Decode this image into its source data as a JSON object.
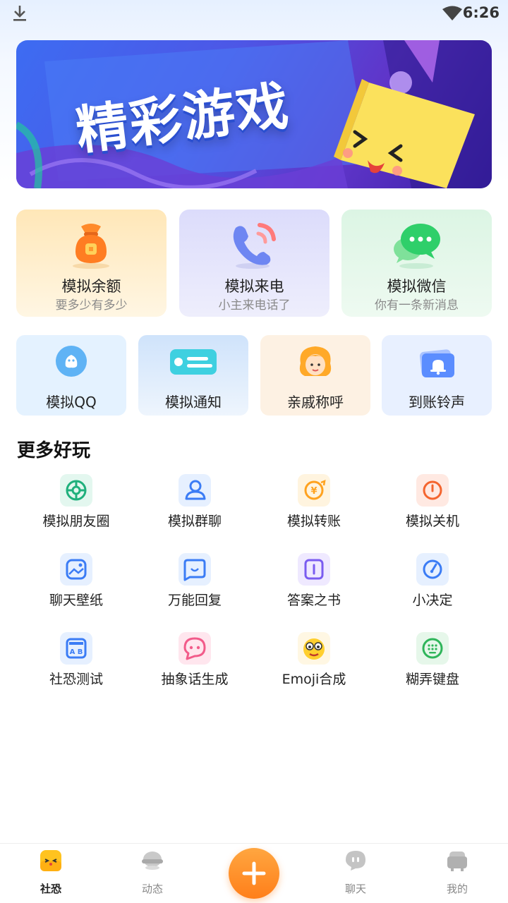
{
  "status_bar": {
    "time": "6:26"
  },
  "banner": {
    "title": "精彩游戏"
  },
  "feature_cards": [
    {
      "title": "模拟余额",
      "subtitle": "要多少有多少",
      "icon": "money-bag-icon"
    },
    {
      "title": "模拟来电",
      "subtitle": "小主来电话了",
      "icon": "phone-call-icon"
    },
    {
      "title": "模拟微信",
      "subtitle": "你有一条新消息",
      "icon": "wechat-icon"
    }
  ],
  "small_cards": [
    {
      "title": "模拟QQ",
      "icon": "qq-icon"
    },
    {
      "title": "模拟通知",
      "icon": "notification-icon"
    },
    {
      "title": "亲戚称呼",
      "icon": "relative-avatar-icon"
    },
    {
      "title": "到账铃声",
      "icon": "bell-icon"
    }
  ],
  "more": {
    "title": "更多好玩",
    "items": [
      {
        "label": "模拟朋友圈",
        "icon": "moments-icon"
      },
      {
        "label": "模拟群聊",
        "icon": "group-chat-icon"
      },
      {
        "label": "模拟转账",
        "icon": "transfer-icon"
      },
      {
        "label": "模拟关机",
        "icon": "power-icon"
      },
      {
        "label": "聊天壁纸",
        "icon": "wallpaper-icon"
      },
      {
        "label": "万能回复",
        "icon": "reply-icon"
      },
      {
        "label": "答案之书",
        "icon": "answer-book-icon"
      },
      {
        "label": "小决定",
        "icon": "decision-icon"
      },
      {
        "label": "社恐测试",
        "icon": "social-test-icon"
      },
      {
        "label": "抽象话生成",
        "icon": "abstract-talk-icon"
      },
      {
        "label": "Emoji合成",
        "icon": "emoji-mix-icon"
      },
      {
        "label": "糊弄键盘",
        "icon": "keyboard-icon"
      }
    ]
  },
  "bottom_nav": {
    "items": [
      {
        "label": "社恐",
        "icon": "home-face-icon"
      },
      {
        "label": "动态",
        "icon": "feed-icon"
      },
      {
        "label": "聊天",
        "icon": "chat-icon"
      },
      {
        "label": "我的",
        "icon": "profile-icon"
      }
    ],
    "fab_icon": "plus-icon"
  },
  "colors": {
    "accent_orange": "#ff8a1f",
    "banner_blue": "#4d57e6",
    "card_yellow": "#ffe7b8",
    "card_purple": "#dcdcfb",
    "card_green": "#dcf5e4"
  }
}
